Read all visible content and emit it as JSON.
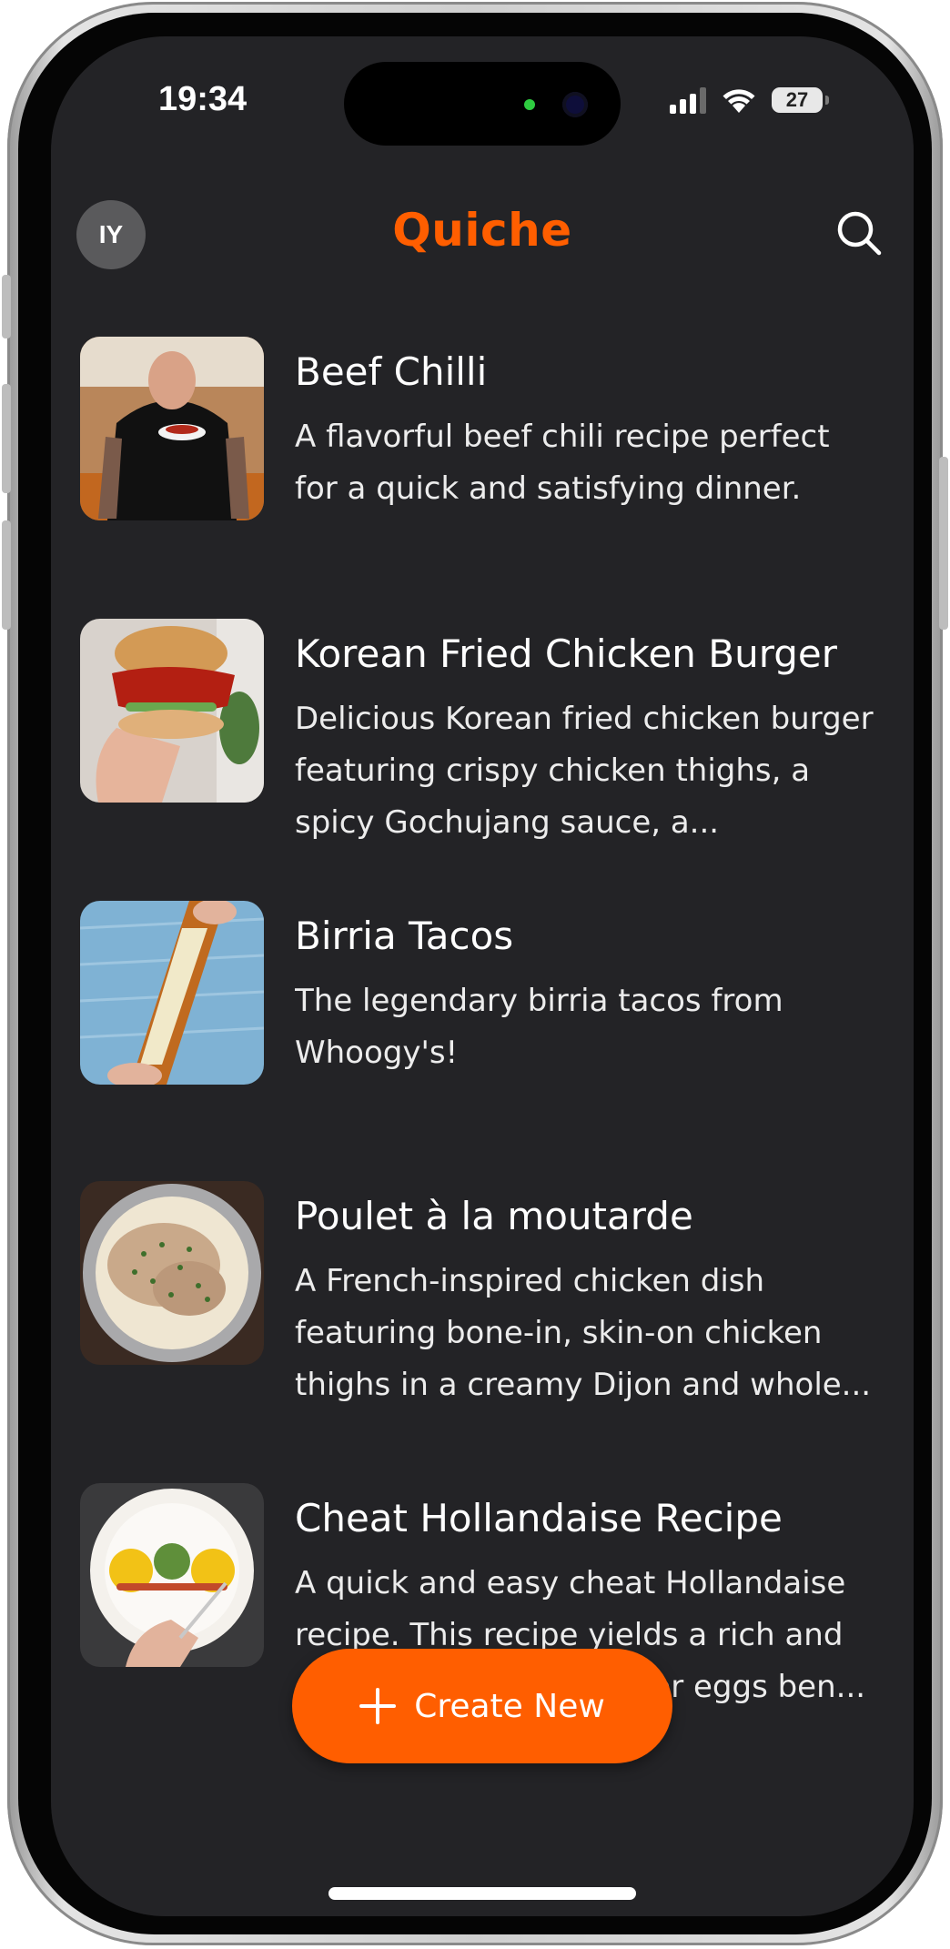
{
  "status_bar": {
    "time": "19:34",
    "battery": "27"
  },
  "header": {
    "avatar_initials": "IY",
    "title": "Quiche"
  },
  "recipes": [
    {
      "title": "Beef Chilli",
      "description": "A flavorful beef chili recipe perfect for a quick and satisfying dinner."
    },
    {
      "title": "Korean Fried Chicken Burger",
      "description": "Delicious Korean fried chicken burger featuring crispy chicken thighs, a spicy Gochujang sauce, a..."
    },
    {
      "title": "Birria Tacos",
      "description": "The legendary birria tacos from Whoogy's!"
    },
    {
      "title": "Poulet à la moutarde",
      "description": "A French-inspired chicken dish featuring bone-in, skin-on chicken thighs in a creamy Dijon and whole..."
    },
    {
      "title": "Cheat Hollandaise Recipe",
      "description": "A quick and easy cheat Hollandaise recipe. This recipe yields a rich and creamy sauce perfect for eggs ben..."
    }
  ],
  "fab": {
    "label": "Create New"
  },
  "colors": {
    "accent": "#ff5e00",
    "background": "#232326",
    "avatar": "#5a5a5c"
  }
}
